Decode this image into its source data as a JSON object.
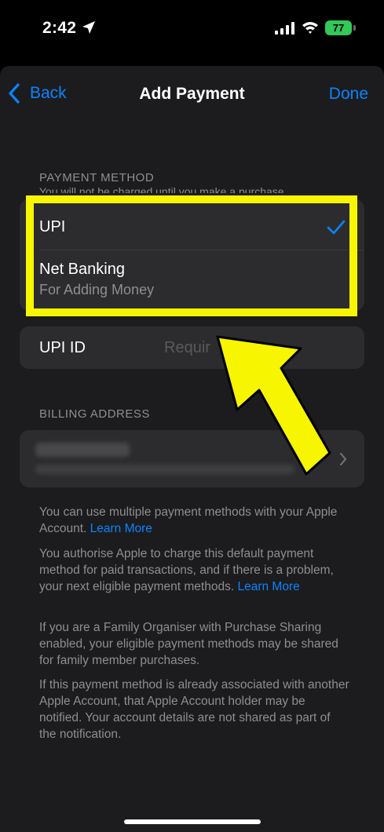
{
  "status_bar": {
    "time": "2:42",
    "battery": "77"
  },
  "nav": {
    "back_label": "Back",
    "title": "Add Payment",
    "done_label": "Done"
  },
  "payment_method": {
    "header": "PAYMENT METHOD",
    "subheader": "You will not be charged until you make a purchase.",
    "options": [
      {
        "label": "UPI",
        "selected": true
      },
      {
        "label": "Net Banking",
        "sublabel": "For Adding Money",
        "selected": false
      }
    ]
  },
  "upi_id": {
    "label": "UPI ID",
    "placeholder": "Requir"
  },
  "billing_address": {
    "header": "BILLING ADDRESS"
  },
  "info": {
    "p1": "You can use multiple payment methods with your Apple Account.",
    "p1_link": "Learn More",
    "p2": "You authorise Apple to charge this default payment method for paid transactions, and if there is a problem, your next eligible payment methods.",
    "p2_link": "Learn More",
    "p3": "If you are a Family Organiser with Purchase Sharing enabled, your eligible payment methods may be shared for family member purchases.",
    "p4": "If this payment method is already associated with another Apple Account, that Apple Account holder may be notified. Your account details are not shared as part of the notification."
  },
  "colors": {
    "accent": "#0a84ff",
    "highlight": "#f7f500",
    "battery": "#34c759"
  }
}
